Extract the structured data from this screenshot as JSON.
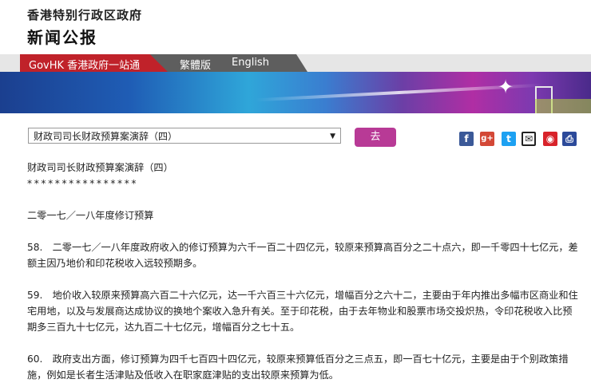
{
  "header": {
    "gov_name": "香港特别行政区政府",
    "press_title": "新闻公报"
  },
  "nav": {
    "govhk": "GovHK 香港政府一站通",
    "trad": "繁體版",
    "english": "English"
  },
  "toolbar": {
    "select_value": "财政司司长财政预算案演辞（四）",
    "go_label": "去",
    "share_icons": [
      "facebook-icon",
      "google-plus-icon",
      "twitter-icon",
      "email-icon",
      "weibo-icon",
      "print-icon"
    ]
  },
  "content": {
    "title": "财政司司长财政预算案演辞（四）",
    "stars": "****************",
    "section": "二零一七／一八年度修订预算",
    "p58": "58.　二零一七／一八年度政府收入的修订预算为六千一百二十四亿元，较原来预算高百分之二十点六，即一千零四十七亿元，差额主因乃地价和印花税收入远较预期多。",
    "p59": "59.　地价收入较原来预算高六百二十六亿元，达一千六百三十六亿元，增幅百分之六十二，主要由于年内推出多幅市区商业和住宅用地，以及与发展商达成协议的换地个案收入急升有关。至于印花税，由于去年物业和股票市场交投炽热，令印花税收入比预期多三百九十七亿元，达九百二十七亿元，增幅百分之七十五。",
    "p60": "60.　政府支出方面，修订预算为四千七百四十四亿元，较原来预算低百分之三点五，即一百七十亿元，主要是由于个别政策措施，例如是长者生活津贴及低收入在职家庭津贴的支出较原来预算为低。"
  },
  "colors": {
    "nav_red": "#c0222a",
    "go_button": "#b83a96",
    "banner_blue": "#1f5db5",
    "banner_magenta": "#b02ea4"
  }
}
